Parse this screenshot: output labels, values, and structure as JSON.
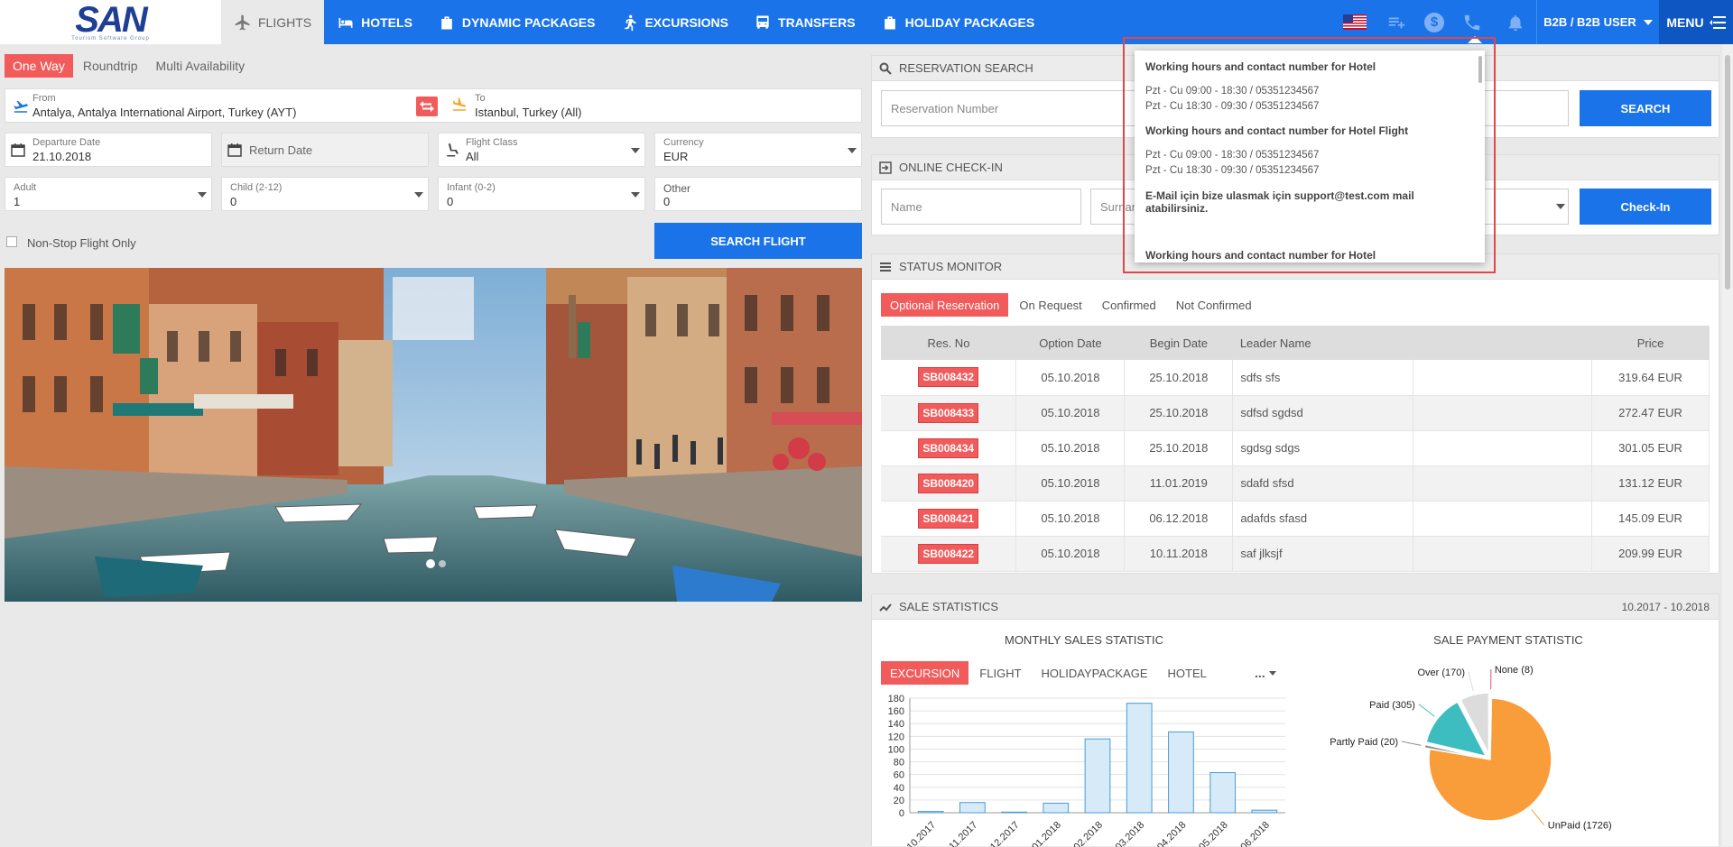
{
  "logo": {
    "text": "SAN",
    "tagline": "Tourism Software Group"
  },
  "nav": [
    {
      "label": "FLIGHTS",
      "icon": "plane-icon",
      "active": true
    },
    {
      "label": "HOTELS",
      "icon": "bed-icon"
    },
    {
      "label": "DYNAMIC PACKAGES",
      "icon": "bag-icon"
    },
    {
      "label": "EXCURSIONS",
      "icon": "walker-icon"
    },
    {
      "label": "TRANSFERS",
      "icon": "bus-icon"
    },
    {
      "label": "HOLIDAY PACKAGES",
      "icon": "bag-icon"
    }
  ],
  "topright": {
    "user_label": "B2B / B2B USER",
    "menu_label": "MENU",
    "flag": "us-flag-icon",
    "currency_symbol": "$"
  },
  "search": {
    "tabs": [
      "One Way",
      "Roundtrip",
      "Multi Availability"
    ],
    "from_label": "From",
    "from_value": "Antalya, Antalya International Airport, Turkey (AYT)",
    "to_label": "To",
    "to_value": "Istanbul, Turkey (All)",
    "departure_label": "Departure Date",
    "departure_value": "21.10.2018",
    "return_label": "Return Date",
    "class_label": "Flight Class",
    "class_value": "All",
    "currency_label": "Currency",
    "currency_value": "EUR",
    "adult_label": "Adult",
    "adult_value": "1",
    "child_label": "Child (2-12)",
    "child_value": "0",
    "infant_label": "Infant (0-2)",
    "infant_value": "0",
    "other_label": "Other",
    "other_value": "0",
    "nonstop_label": "Non-Stop Flight Only",
    "search_button": "SEARCH FLIGHT"
  },
  "reservation": {
    "title": "RESERVATION SEARCH",
    "placeholder": "Reservation Number",
    "button": "SEARCH"
  },
  "checkin": {
    "title": "ONLINE CHECK-IN",
    "name_placeholder": "Name",
    "surname_placeholder": "Surname",
    "button": "Check-In"
  },
  "status": {
    "title": "STATUS MONITOR",
    "tabs": [
      "Optional Reservation",
      "On Request",
      "Confirmed",
      "Not Confirmed"
    ],
    "columns": [
      "Res. No",
      "Option Date",
      "Begin Date",
      "Leader Name",
      "",
      "Price"
    ],
    "rows": [
      {
        "no": "SB008432",
        "option": "05.10.2018",
        "begin": "25.10.2018",
        "leader": "sdfs sfs",
        "price": "319.64 EUR"
      },
      {
        "no": "SB008433",
        "option": "05.10.2018",
        "begin": "25.10.2018",
        "leader": "sdfsd sgdsd",
        "price": "272.47 EUR"
      },
      {
        "no": "SB008434",
        "option": "05.10.2018",
        "begin": "25.10.2018",
        "leader": "sgdsg sdgs",
        "price": "301.05 EUR"
      },
      {
        "no": "SB008420",
        "option": "05.10.2018",
        "begin": "11.01.2019",
        "leader": "sdafd sfsd",
        "price": "131.12 EUR"
      },
      {
        "no": "SB008421",
        "option": "05.10.2018",
        "begin": "06.12.2018",
        "leader": "adafds sfasd",
        "price": "145.09 EUR"
      },
      {
        "no": "SB008422",
        "option": "05.10.2018",
        "begin": "10.11.2018",
        "leader": "saf jlksjf",
        "price": "209.99 EUR"
      }
    ]
  },
  "stats": {
    "title": "SALE STATISTICS",
    "range": "10.2017 - 10.2018",
    "monthly_title": "MONTHLY SALES STATISTIC",
    "payment_title": "SALE PAYMENT STATISTIC",
    "tabs": [
      "EXCURSION",
      "FLIGHT",
      "HOLIDAYPACKAGE",
      "HOTEL"
    ],
    "more": "..."
  },
  "chart_data": [
    {
      "type": "bar",
      "title": "MONTHLY SALES STATISTIC",
      "categories": [
        "10.2017",
        "11.2017",
        "12.2017",
        "01.2018",
        "02.2018",
        "03.2018",
        "04.2018",
        "05.2018",
        "06.2018"
      ],
      "values": [
        2,
        16,
        1,
        15,
        116,
        172,
        127,
        63,
        4
      ],
      "yticks": [
        0,
        20,
        40,
        60,
        80,
        100,
        120,
        140,
        160,
        180
      ],
      "ylim": [
        0,
        180
      ],
      "grid": true,
      "colors": {
        "fill": "#d6eaf8",
        "stroke": "#4a9bd6"
      }
    },
    {
      "type": "pie",
      "title": "SALE PAYMENT STATISTIC",
      "labels": [
        "UnPaid (1726)",
        "Partly Paid (20)",
        "Paid (305)",
        "Over (170)",
        "None (8)"
      ],
      "values": [
        1726,
        20,
        305,
        170,
        8
      ],
      "colors": [
        "#f99d3a",
        "#8e8e8e",
        "#3dbdbf",
        "#dcdcdc",
        "#e0507a"
      ]
    }
  ],
  "popup": {
    "sections": [
      {
        "title": "Working hours and contact number for Hotel",
        "lines": [
          "Pzt - Cu 09:00 - 18:30 / 05351234567",
          "Pzt - Cu 18:30 - 09:30 / 05351234567"
        ]
      },
      {
        "title": "Working hours and contact number for Hotel Flight",
        "lines": [
          "Pzt - Cu 09:00 - 18:30 / 05351234567",
          "Pzt - Cu 18:30 - 09:30 / 05351234567"
        ]
      }
    ],
    "mail": "E-Mail için bize ulasmak için support@test.com mail atabilirsiniz.",
    "last_title": "Working hours and contact number for Hotel"
  }
}
